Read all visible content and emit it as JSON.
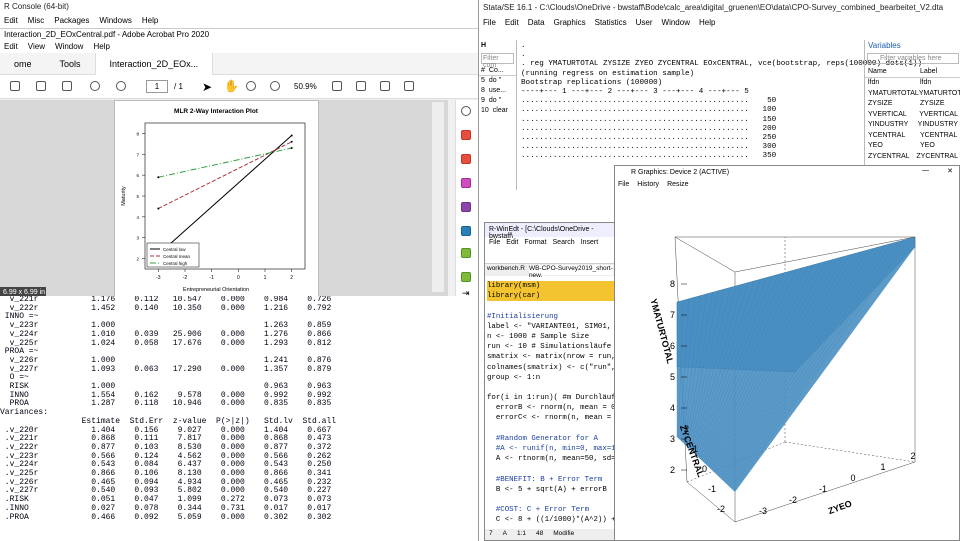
{
  "rconsole": {
    "title": "R Console (64-bit)",
    "menu": [
      "Edit",
      "Misc",
      "Packages",
      "Windows",
      "Help"
    ],
    "lines": [
      "  v_221r           1.176    0.112   10.547    0.000    0.984    0.726",
      "  v_222r           1.452    0.140   10.350    0.000    1.216    0.792",
      " INNO =~",
      "  v_223r           1.000                               1.263    0.859",
      "  v_224r           1.010    0.039   25.906    0.000    1.276    0.866",
      "  v_225r           1.024    0.058   17.676    0.000    1.293    0.812",
      " PROA =~",
      "  v_226r           1.000                               1.241    0.876",
      "  v_227r           1.093    0.063   17.290    0.000    1.357    0.879",
      "  O =~",
      "  RISK             1.000                               0.963    0.963",
      "  INNO             1.554    0.162    9.578    0.000    0.992    0.992",
      "  PROA             1.287    0.118   10.946    0.000    0.835    0.835",
      "",
      "Variances:",
      "                 Estimate  Std.Err  z-value  P(>|z|)   Std.lv  Std.all",
      " .v_220r           1.404    0.156    9.027    0.000    1.404    0.667",
      " .v_221r           0.868    0.111    7.817    0.000    0.868    0.473",
      " .v_222r           0.877    0.103    8.530    0.000    0.877    0.372",
      " .v_223r           0.566    0.124    4.562    0.000    0.566    0.262",
      " .v_224r           0.543    0.084    6.437    0.000    0.543    0.250",
      " .v_225r           0.866    0.106    8.130    0.000    0.866    0.341",
      " .v_226r           0.465    0.094    4.934    0.000    0.465    0.232",
      " .v_227r           0.540    0.093    5.802    0.000    0.540    0.227",
      " .RISK             0.051    0.047    1.099    0.272    0.073    0.073",
      " .INNO             0.027    0.078    0.344    0.731    0.017    0.017",
      " .PROA             0.466    0.092    5.059    0.000    0.302    0.302"
    ]
  },
  "acrobat": {
    "title": "Interaction_2D_EOxCentral.pdf - Adobe Acrobat Pro 2020",
    "menu": [
      "Edit",
      "View",
      "Window",
      "Help"
    ],
    "tabs": [
      "ome",
      "Tools",
      "Interaction_2D_EOx..."
    ],
    "page_current": "1",
    "page_total": "/ 1",
    "zoom": "50.9%",
    "size_badge": "6.99 x 6.99 in",
    "plot": {
      "title": "MLR 2-Way Interaction Plot",
      "xlabel": "Entrepreneurial Orientation",
      "ylabel": "Maturity",
      "xticks": [
        "-3",
        "-2",
        "-1",
        "0",
        "1",
        "2"
      ],
      "yticks": [
        "2",
        "3",
        "4",
        "5",
        "6",
        "7",
        "8"
      ],
      "legend": [
        "Central low",
        "Central mean",
        "Central high"
      ],
      "colors": [
        "#000000",
        "#b03040",
        "#30a040"
      ]
    }
  },
  "stata": {
    "title": "Stata/SE 16.1 - C:\\Clouds\\OneDrive - bwstaff\\Bode\\calc_area\\digital_gruenen\\EO\\data\\CPO-Survey_combined_bearbeitet_V2.dta",
    "menu": [
      "File",
      "Edit",
      "Data",
      "Graphics",
      "Statistics",
      "User",
      "Window",
      "Help"
    ],
    "history": {
      "filter": "Filter com",
      "head": [
        "#",
        "Co..."
      ],
      "rows": [
        [
          "5",
          "do \""
        ],
        [
          "8",
          "use..."
        ],
        [
          "9",
          "do \""
        ],
        [
          "10",
          "clear"
        ]
      ]
    },
    "results": [
      ".",
      ".",
      ". reg YMATURTOTAL ZYSIZE ZYEO ZYCENTRAL EOxCENTRAL, vce(bootstrap, reps(100000) dots(1))",
      "(running regress on estimation sample)",
      "",
      "Bootstrap replications (100000)",
      "----+--- 1 ---+--- 2 ---+--- 3 ---+--- 4 ---+--- 5",
      "..................................................    50",
      "..................................................   100",
      "..................................................   150",
      "..................................................   200",
      "..................................................   250",
      "..................................................   300",
      "..................................................   350"
    ],
    "variables": {
      "title": "Variables",
      "filter": "Filter variables here",
      "cols": [
        "Name",
        "Label"
      ],
      "rows": [
        [
          "lfdn",
          "lfdn"
        ],
        [
          "YMATURTOTAL",
          "YMATURTOTAL"
        ],
        [
          "ZYSIZE",
          "ZYSIZE"
        ],
        [
          "YVERTICAL",
          "YVERTICAL"
        ],
        [
          "YINDUSTRY",
          "YINDUSTRY"
        ],
        [
          "YCENTRAL",
          "YCENTRAL"
        ],
        [
          "YEO",
          "YEO"
        ],
        [
          "ZYCENTRAL",
          "ZYCENTRAL"
        ]
      ]
    }
  },
  "winedt": {
    "title": "R-WinEdt - [C:\\Clouds\\OneDrive - bwstaff\\",
    "menu": [
      "File",
      "Edit",
      "Format",
      "Search",
      "Insert"
    ],
    "tabs": [
      "workbench.R",
      "WB-CPO-Survey2019_short-new."
    ],
    "code": [
      [
        "lib",
        "library(msm)"
      ],
      [
        "lib",
        "library(car)"
      ],
      [
        "",
        ""
      ],
      [
        "cm",
        "#Initialisierung"
      ],
      [
        "",
        "label <- \"VARIANTE01, SIM01, u"
      ],
      [
        "",
        "n <- 1000 # Sample Size"
      ],
      [
        "",
        "run <- 10 # Simulationsläufe"
      ],
      [
        "",
        "smatrix <- matrix(nrow = run,"
      ],
      [
        "",
        "colnames(smatrix) <- c(\"run\","
      ],
      [
        "",
        "group <- 1:n"
      ],
      [
        "",
        ""
      ],
      [
        "",
        "for(i in 1:run)( #m Durchläufe"
      ],
      [
        "",
        "  errorB <- rnorm(n, mean = 0,"
      ],
      [
        "",
        "  errorC< <- rnorm(n, mean = 0,"
      ],
      [
        "",
        ""
      ],
      [
        "cm",
        "  #Random Generator for A"
      ],
      [
        "cm",
        "  #A <- runif(n, min=0, max=10"
      ],
      [
        "",
        "  A <- rtnorm(n, mean=50, sd=2"
      ],
      [
        "",
        ""
      ],
      [
        "cm",
        "  #BENEFIT: B + Error Term"
      ],
      [
        "",
        "  B <- 5 + sqrt(A) + errorB"
      ],
      [
        "",
        ""
      ],
      [
        "cm",
        "  #COST: C + Error Term"
      ],
      [
        "",
        "  C <- 8 + ((1/1000)*(A^2)) +"
      ],
      [
        "",
        ""
      ],
      [
        "cm",
        "  #SUCCESS: S(B, C)"
      ]
    ],
    "status": [
      "7",
      "A",
      "1:1",
      "48",
      "Modifie"
    ]
  },
  "rgraphics": {
    "title": "R Graphics: Device 2 (ACTIVE)",
    "menu": [
      "File",
      "History",
      "Resize"
    ],
    "zlabel": "YMATURTOTAL",
    "xlabel": "ZYEO",
    "ylabel": "ZYCENTRAL",
    "zticks": [
      "2",
      "3",
      "4",
      "5",
      "6",
      "7",
      "8"
    ],
    "xticks": [
      "-3",
      "-2",
      "-1",
      "0",
      "1",
      "2"
    ],
    "yticks": [
      "-2",
      "-1",
      "0",
      "1",
      "2"
    ],
    "surface_color": "#4a8fc2"
  }
}
